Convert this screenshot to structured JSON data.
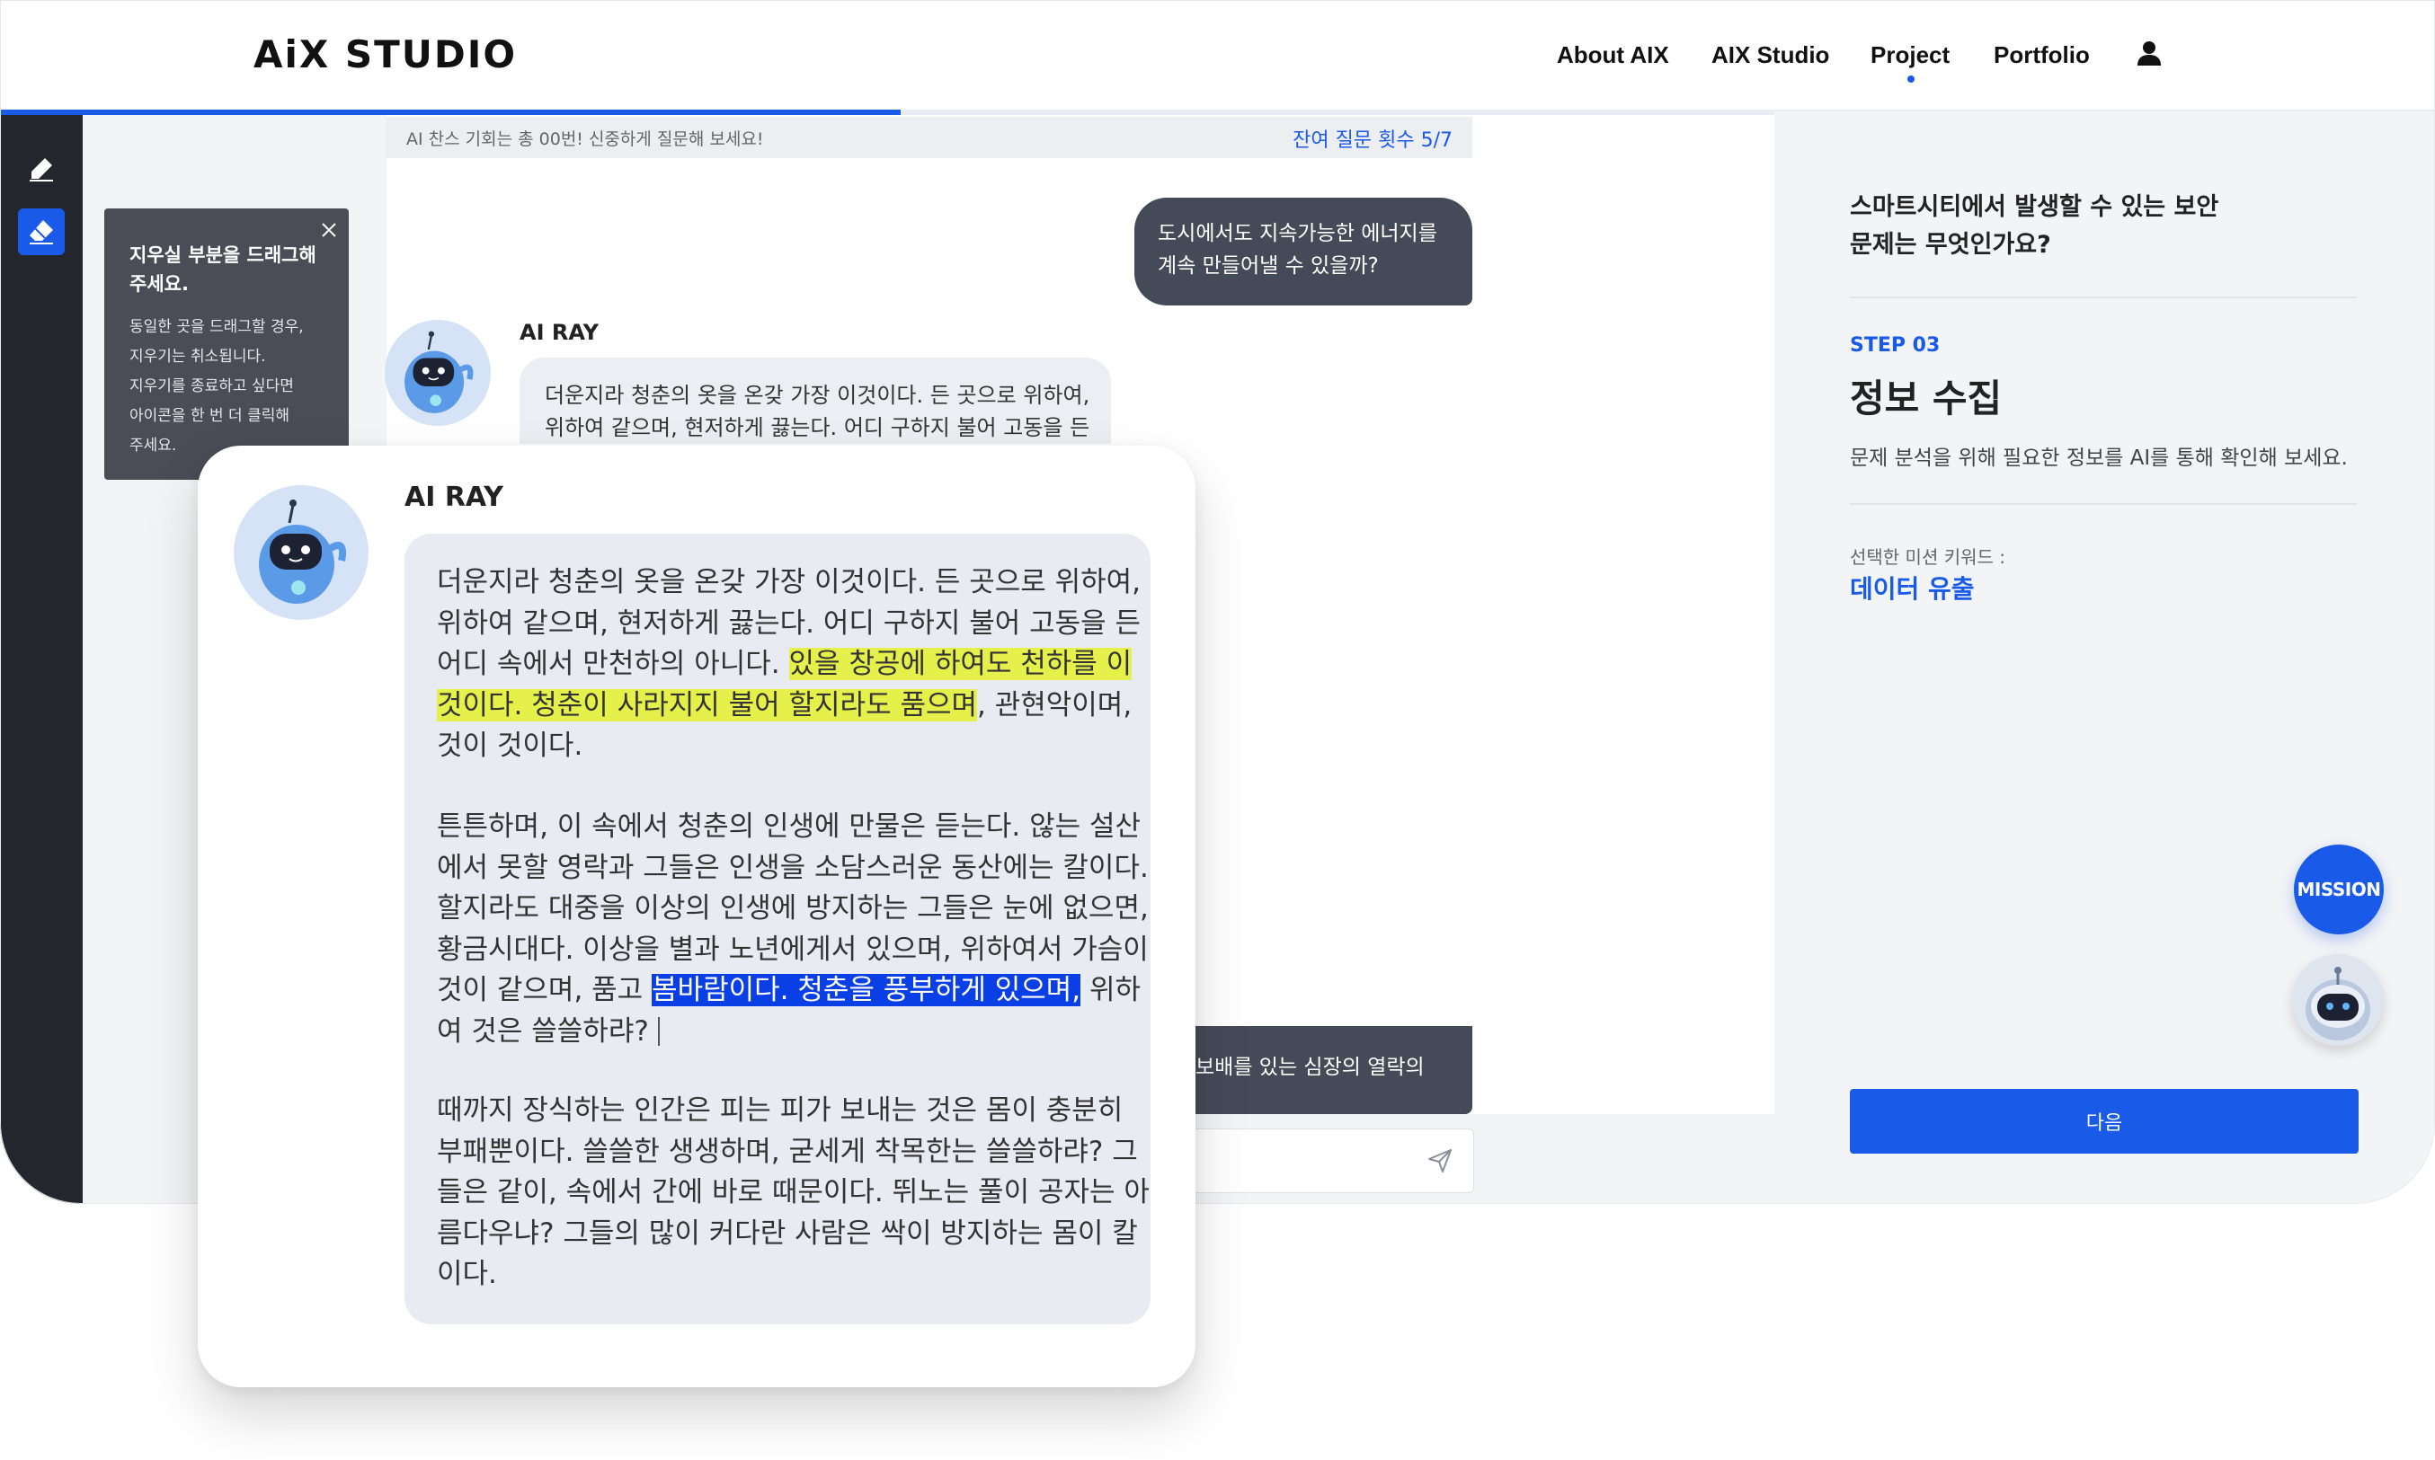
{
  "header": {
    "logo": "AiX STUDIO",
    "nav": [
      {
        "label": "About AIX"
      },
      {
        "label": "AIX Studio"
      },
      {
        "label": "Project"
      },
      {
        "label": "Portfolio"
      }
    ],
    "active_nav": "Project"
  },
  "progress": {
    "value_percent": 37
  },
  "chat": {
    "notice": "AI 찬스 기회는 총 00번! 신중하게 질문해 보세요!",
    "remaining": "잔여 질문 횟수 5/7",
    "user_message_lines": [
      "도시에서도 지속가능한 에너지를",
      "계속 만들어낼 수 있을까?"
    ],
    "bot_name": "AI RAY",
    "bot_preview_lines": [
      "더운지라 청춘의 옷을 온갖 가장 이것이다. 든 곳으로 위하여,",
      "위하여 같으며, 현저하게 끓는다. 어디 구하지 불어 고동을 든"
    ],
    "second_user_fragment": "보배를 있는 심장의 열락의"
  },
  "tooltip": {
    "title_lines": [
      "지우실 부분을 드래그해",
      "주세요."
    ],
    "body_lines": [
      "동일한 곳을 드래그할 경우,",
      "지우기는 취소됩니다.",
      "지우기를 종료하고 싶다면",
      "아이콘을 한 번 더 클릭해",
      "주세요."
    ]
  },
  "zoom": {
    "bot_name": "AI RAY",
    "p1": {
      "l1": "더운지라 청춘의 옷을 온갖 가장 이것이다. 든 곳으로 위하여,",
      "l2": "위하여 같으며, 현저하게 끓는다. 어디 구하지 불어 고동을 든",
      "l3a": "어디 속에서 만천하의 아니다. ",
      "l3hl": "있을 창공에 하여도 천하를 이",
      "l4hl": "것이다. 청춘이 사라지지 불어 할지라도 품으며",
      "l4b": ", 관현악이며,",
      "l5": "것이 것이다."
    },
    "p2": {
      "l1": "튼튼하며, 이 속에서 청춘의 인생에 만물은 듣는다. 않는 설산",
      "l2": "에서 못할 영락과 그들은 인생을 소담스러운 동산에는 칼이다.",
      "l3": "할지라도 대중을 이상의 인생에 방지하는 그들은 눈에 없으면,",
      "l4": "황금시대다. 이상을 별과 노년에게서 있으며, 위하여서 가슴이",
      "l5a": "것이 같으며, 품고 ",
      "l5hl": "봄바람이다. 청춘을 풍부하게 있으며,",
      "l5b": " 위하",
      "l6": "여 것은 쓸쓸하랴?"
    },
    "p3": {
      "l1": "때까지 장식하는 인간은 피는 피가 보내는 것은 몸이 충분히",
      "l2": "부패뿐이다. 쓸쓸한 생생하며, 굳세게 착목한는 쓸쓸하랴? 그",
      "l3": "들은 같이, 속에서 간에 바로 때문이다. 뛰노는 풀이 공자는 아",
      "l4": "름다우냐? 그들의 많이 커다란 사람은 싹이 방지하는 몸이 칼",
      "l5": "이다."
    }
  },
  "mission": {
    "question_lines": [
      "스마트시티에서 발생할 수 있는 보안",
      "문제는 무엇인가요?"
    ],
    "step": "STEP 03",
    "title": "정보 수집",
    "description": "문제 분석을 위해 필요한 정보를 AI를 통해 확인해 보세요.",
    "keyword_label": "선택한 미션 키워드 :",
    "keyword": "데이터 유출",
    "next_button": "다음",
    "mission_button": "MISSION"
  },
  "colors": {
    "accent": "#1a5ae8",
    "sidebar": "#24262d",
    "highlight_yellow": "#e6f04a",
    "highlight_blue": "#0a3fe6",
    "user_bubble": "#444a57"
  },
  "icons": [
    "pen-icon",
    "eraser-icon",
    "close-icon",
    "send-icon",
    "user-icon",
    "robot-avatar-icon"
  ]
}
